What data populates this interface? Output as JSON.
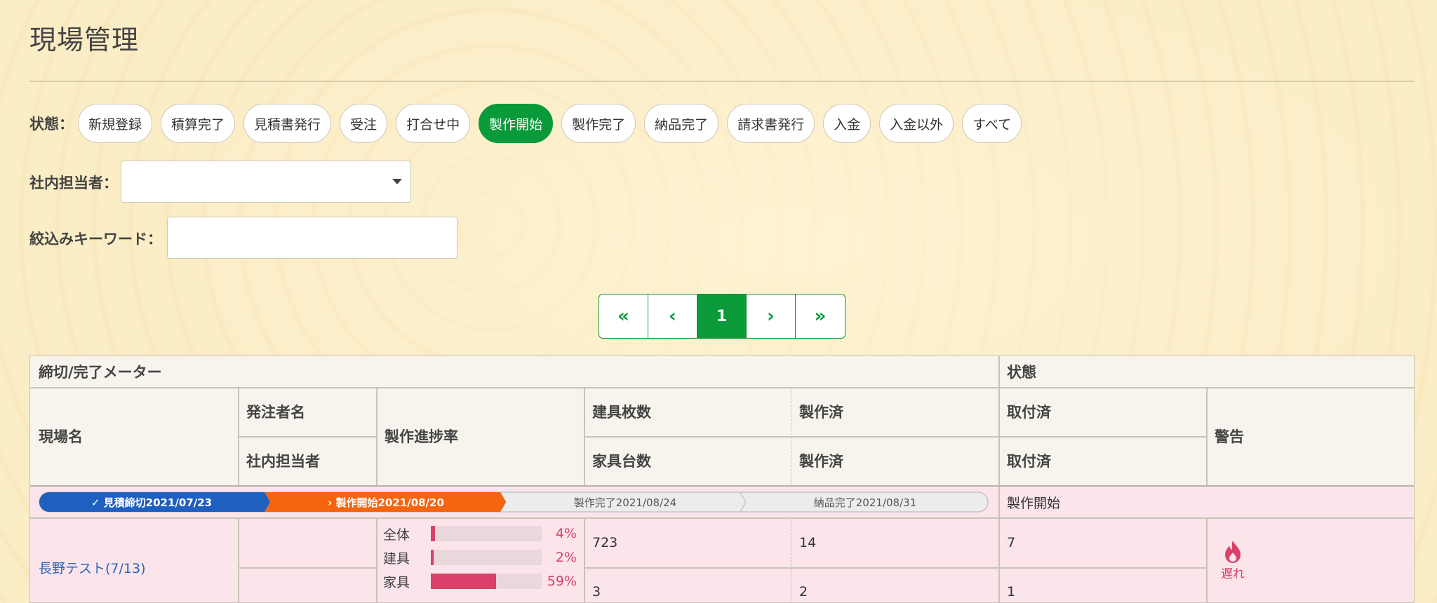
{
  "page": {
    "title": "現場管理"
  },
  "filters": {
    "status_label": "状態：",
    "status_options": [
      {
        "label": "新規登録",
        "active": false
      },
      {
        "label": "積算完了",
        "active": false
      },
      {
        "label": "見積書発行",
        "active": false
      },
      {
        "label": "受注",
        "active": false
      },
      {
        "label": "打合せ中",
        "active": false
      },
      {
        "label": "製作開始",
        "active": true
      },
      {
        "label": "製作完了",
        "active": false
      },
      {
        "label": "納品完了",
        "active": false
      },
      {
        "label": "請求書発行",
        "active": false
      },
      {
        "label": "入金",
        "active": false
      },
      {
        "label": "入金以外",
        "active": false
      },
      {
        "label": "すべて",
        "active": false
      }
    ],
    "staff_label": "社内担当者：",
    "staff_value": "",
    "keyword_label": "絞込みキーワード：",
    "keyword_value": ""
  },
  "pagination": {
    "first": "«",
    "prev": "‹",
    "current": "1",
    "next": "›",
    "last": "»"
  },
  "table": {
    "headers": {
      "meter": "締切/完了メーター",
      "status": "状態",
      "site_name": "現場名",
      "orderer": "発注者名",
      "staff": "社内担当者",
      "progress": "製作進捗率",
      "fitting_count": "建具枚数",
      "furniture_count": "家具台数",
      "made1": "製作済",
      "made2": "製作済",
      "installed1": "取付済",
      "installed2": "取付済",
      "warning": "警告"
    },
    "row": {
      "milestones": [
        {
          "label": "✓ 見積締切2021/07/23",
          "state": "done"
        },
        {
          "label": "› 製作開始2021/08/20",
          "state": "current"
        },
        {
          "label": "製作完了2021/08/24",
          "state": "todo"
        },
        {
          "label": "納品完了2021/08/31",
          "state": "todo"
        }
      ],
      "status": "製作開始",
      "site_name": "長野テスト(7/13)",
      "orderer": "",
      "staff": "",
      "progress": [
        {
          "label": "全体",
          "pct": 4,
          "text": "4%"
        },
        {
          "label": "建具",
          "pct": 2,
          "text": "2%"
        },
        {
          "label": "家具",
          "pct": 59,
          "text": "59%"
        }
      ],
      "fitting_count": "723",
      "fitting_made": "14",
      "fitting_installed": "7",
      "furniture_count": "3",
      "furniture_made": "2",
      "furniture_installed": "1",
      "warning": {
        "icon": "fire-icon",
        "label": "遅れ"
      }
    }
  },
  "colors": {
    "accent_green": "#0a9a3a",
    "milestone_done": "#1f5fbf",
    "milestone_current": "#f5650f",
    "alert_pink": "#d9406a"
  }
}
